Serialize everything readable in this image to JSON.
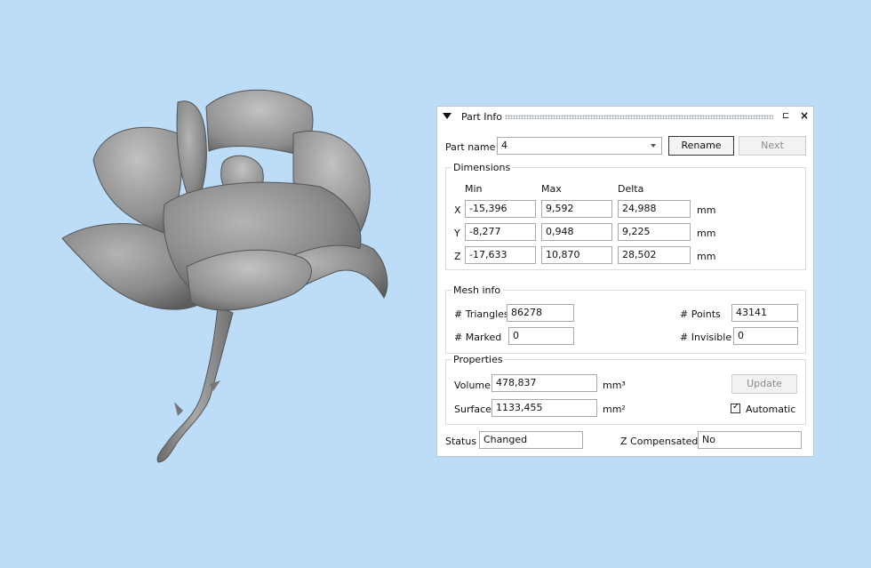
{
  "panel": {
    "title": "Part Info",
    "pin_glyph": "⊏",
    "close_glyph": "×"
  },
  "part_name": {
    "label": "Part name",
    "value": "4",
    "rename_label": "Rename",
    "next_label": "Next"
  },
  "dimensions": {
    "title": "Dimensions",
    "headers": [
      "Min",
      "Max",
      "Delta"
    ],
    "unit": "mm",
    "rows": [
      {
        "axis": "X",
        "min": "-15,396",
        "max": "9,592",
        "delta": "24,988"
      },
      {
        "axis": "Y",
        "min": "-8,277",
        "max": "0,948",
        "delta": "9,225"
      },
      {
        "axis": "Z",
        "min": "-17,633",
        "max": "10,870",
        "delta": "28,502"
      }
    ]
  },
  "mesh_info": {
    "title": "Mesh info",
    "triangles_label": "# Triangles",
    "triangles_value": "86278",
    "points_label": "# Points",
    "points_value": "43141",
    "marked_label": "# Marked",
    "marked_value": "0",
    "invisible_label": "# Invisible",
    "invisible_value": "0"
  },
  "properties": {
    "title": "Properties",
    "volume_label": "Volume",
    "volume_value": "478,837",
    "volume_unit": "mm³",
    "surface_label": "Surface",
    "surface_value": "1133,455",
    "surface_unit": "mm²",
    "update_label": "Update",
    "automatic_label": "Automatic",
    "automatic_checked": true
  },
  "status": {
    "label": "Status",
    "value": "Changed",
    "z_label": "Z Compensated",
    "z_value": "No"
  },
  "colors": {
    "background": "#bcdcf8",
    "model": "#8c8c8c"
  }
}
